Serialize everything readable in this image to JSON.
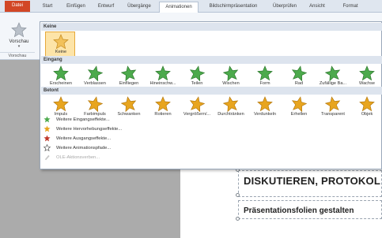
{
  "tabs": [
    {
      "label": "Datei"
    },
    {
      "label": "Start"
    },
    {
      "label": "Einfügen"
    },
    {
      "label": "Entwurf"
    },
    {
      "label": "Übergänge"
    },
    {
      "label": "Animationen"
    },
    {
      "label": "Bildschirmpräsentation"
    },
    {
      "label": "Überprüfen"
    },
    {
      "label": "Ansicht"
    },
    {
      "label": "Format"
    }
  ],
  "ribbon": {
    "preview_button": "Vorschau",
    "preview_caret": "▾",
    "preview_group": "Vorschau"
  },
  "gallery": {
    "sections": {
      "none": "Keine",
      "entrance": "Eingang",
      "emphasis": "Betont"
    },
    "none_item": "Keine",
    "entrance_items": [
      "Erscheinen",
      "Verblassen",
      "Einfliegen",
      "Hineinschw...",
      "Teilen",
      "Wischen",
      "Form",
      "Rad",
      "Zufällige Ba...",
      "Wachse"
    ],
    "emphasis_items": [
      "Impuls",
      "Farbimpuls",
      "Schwanken",
      "Rotieren",
      "Vergrößern/...",
      "Durchtränken",
      "Verdunkeln",
      "Erhellen",
      "Transparent",
      "Objek"
    ],
    "more_items": [
      "Weitere Eingangseffekte...",
      "Weitere Hervorhebungseffekte...",
      "Weitere Ausgangseffekte...",
      "Weitere Animationspfade...",
      "OLE-Aktionsverben..."
    ],
    "colors": {
      "entrance": "#4caa4c",
      "emphasis": "#e8a51f",
      "exit": "#c0392b",
      "none": "#e3a232"
    }
  },
  "slide": {
    "title": "DISKUTIEREN, PROTOKOL",
    "subtitle": "Präsentationsfolien gestalten"
  }
}
